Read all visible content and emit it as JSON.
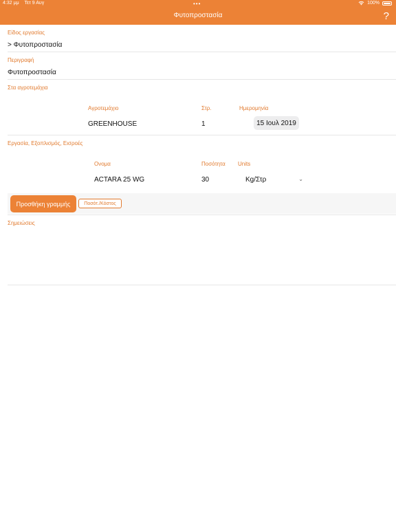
{
  "status_bar": {
    "time": "4:32 μμ",
    "date": "Τετ 9 Αυγ",
    "battery": "100%"
  },
  "header": {
    "title": "Φυτοπροστασία",
    "help_label": "?"
  },
  "form": {
    "work_type": {
      "label": "Είδος εργασίας",
      "value": "> Φυτοπροστασία"
    },
    "description": {
      "label": "Περιγραφή",
      "value": "Φυτοπροστασία"
    },
    "fields_section": {
      "label": "Στα αγροτεμάχια",
      "columns": [
        "Αγροτεμάχιο",
        "Στρ.",
        "Ημερομηνία"
      ],
      "rows": [
        {
          "field": "GREENHOUSE",
          "area": "1",
          "date": "15 Ιουλ 2019"
        }
      ]
    },
    "inputs_section": {
      "label": "Εργασία, Εξοπλισμός, Εισροές",
      "columns": [
        "Ονομα",
        "Ποσότητα",
        "Units"
      ],
      "rows": [
        {
          "name": "ACTARA 25 WG",
          "quantity": "30",
          "unit": "Kg/Στρ"
        }
      ],
      "add_line_label": "Προσθήκη γραμμής",
      "qty_cost_label": "Ποσότ./Κόστος"
    },
    "notes": {
      "label": "Σημειώσεις"
    }
  },
  "colors": {
    "accent": "#ec8236",
    "label": "#e17a2e",
    "divider": "#e6e6e6"
  }
}
